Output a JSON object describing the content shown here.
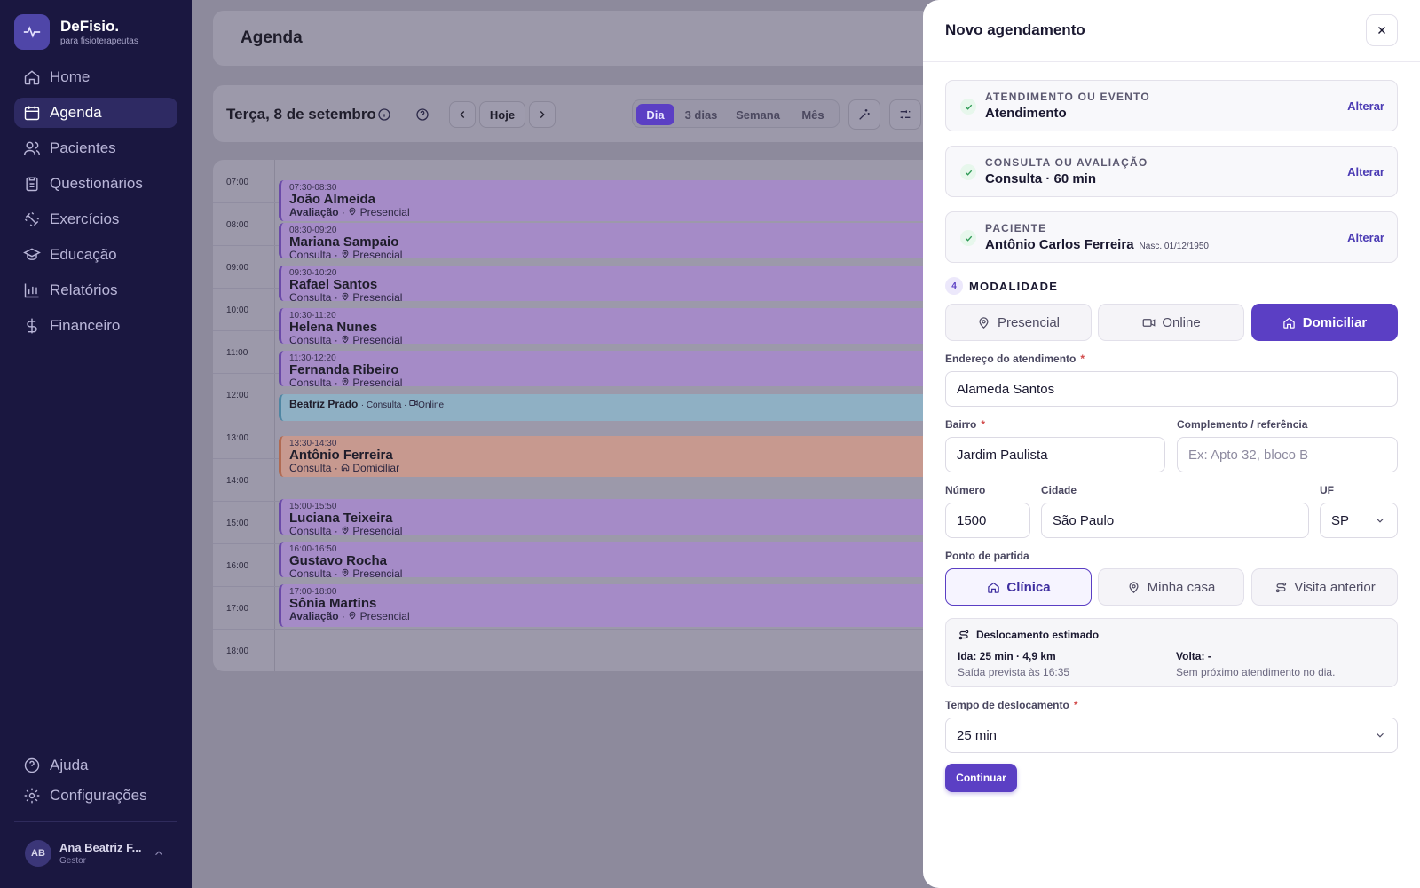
{
  "brand": {
    "name": "DeFisio.",
    "tagline": "para fisioterapeutas"
  },
  "nav": [
    {
      "label": "Home",
      "icon": "home-icon"
    },
    {
      "label": "Agenda",
      "icon": "calendar-icon",
      "active": true
    },
    {
      "label": "Pacientes",
      "icon": "users-icon"
    },
    {
      "label": "Questionários",
      "icon": "clipboard-icon"
    },
    {
      "label": "Exercícios",
      "icon": "dumbbell-icon"
    },
    {
      "label": "Educação",
      "icon": "graduation-icon"
    },
    {
      "label": "Relatórios",
      "icon": "bar-chart-icon"
    },
    {
      "label": "Financeiro",
      "icon": "dollar-icon"
    }
  ],
  "nav_bottom": [
    {
      "label": "Ajuda",
      "icon": "help-icon"
    },
    {
      "label": "Configurações",
      "icon": "gear-icon"
    }
  ],
  "user": {
    "initials": "AB",
    "name": "Ana Beatriz F...",
    "role": "Gestor"
  },
  "header": {
    "title": "Agenda"
  },
  "toolbar": {
    "date": "Terça, 8 de setembro",
    "today": "Hoje",
    "views": [
      "Dia",
      "3 dias",
      "Semana",
      "Mês"
    ],
    "active_view": "Dia"
  },
  "calendar": {
    "hours": [
      "07:00",
      "08:00",
      "09:00",
      "10:00",
      "11:00",
      "12:00",
      "13:00",
      "14:00",
      "15:00",
      "16:00",
      "17:00",
      "18:00"
    ],
    "events": [
      {
        "time": "07:30-08:30",
        "name": "João Almeida",
        "type": "Avaliação",
        "mode": "Presencial"
      },
      {
        "time": "08:30-09:20",
        "name": "Mariana Sampaio",
        "type": "Consulta",
        "mode": "Presencial"
      },
      {
        "time": "09:30-10:20",
        "name": "Rafael Santos",
        "type": "Consulta",
        "mode": "Presencial"
      },
      {
        "time": "10:30-11:20",
        "name": "Helena Nunes",
        "type": "Consulta",
        "mode": "Presencial"
      },
      {
        "time": "11:30-12:20",
        "name": "Fernanda Ribeiro",
        "type": "Consulta",
        "mode": "Presencial"
      },
      {
        "time": "",
        "name": "Beatriz Prado",
        "type": "Consulta",
        "mode": "Online"
      },
      {
        "time": "13:30-14:30",
        "name": "Antônio Ferreira",
        "type": "Consulta",
        "mode": "Domiciliar"
      },
      {
        "time": "15:00-15:50",
        "name": "Luciana Teixeira",
        "type": "Consulta",
        "mode": "Presencial"
      },
      {
        "time": "16:00-16:50",
        "name": "Gustavo Rocha",
        "type": "Consulta",
        "mode": "Presencial"
      },
      {
        "time": "17:00-18:00",
        "name": "Sônia Martins",
        "type": "Avaliação",
        "mode": "Presencial"
      }
    ],
    "colors": {
      "presencial": "#a58bc7",
      "online": "#8fb0c4",
      "domiciliar": "#c7998f"
    }
  },
  "modal": {
    "title": "Novo agendamento",
    "steps": [
      {
        "label": "ATENDIMENTO OU EVENTO",
        "value": "Atendimento",
        "extra": "",
        "action": "Alterar"
      },
      {
        "label": "CONSULTA OU AVALIAÇÃO",
        "value": "Consulta · 60 min",
        "extra": "",
        "action": "Alterar"
      },
      {
        "label": "PACIENTE",
        "value": "Antônio Carlos Ferreira",
        "extra": "Nasc. 01/12/1950",
        "action": "Alterar"
      }
    ],
    "modality": {
      "number": "4",
      "title": "MODALIDADE",
      "options": [
        "Presencial",
        "Online",
        "Domiciliar"
      ],
      "selected": "Domiciliar"
    },
    "form": {
      "address_label": "Endereço do atendimento",
      "address_value": "Alameda Santos",
      "bairro_label": "Bairro",
      "bairro_value": "Jardim Paulista",
      "complement_label": "Complemento / referência",
      "complement_placeholder": "Ex: Apto 32, bloco B",
      "number_label": "Número",
      "number_value": "1500",
      "city_label": "Cidade",
      "city_value": "São Paulo",
      "uf_label": "UF",
      "uf_value": "SP",
      "start_label": "Ponto de partida",
      "start_options": [
        "Clínica",
        "Minha casa",
        "Visita anterior"
      ],
      "start_selected": "Clínica",
      "travel": {
        "title": "Deslocamento estimado",
        "go": "Ida: 25 min · 4,9 km",
        "go_note": "Saída prevista às 16:35",
        "back": "Volta: -",
        "back_note": "Sem próximo atendimento no dia."
      },
      "travel_time_label": "Tempo de deslocamento",
      "travel_time_value": "25 min",
      "required_mark": "*"
    },
    "continue": "Continuar"
  },
  "accent_color": "#5b3fc4"
}
